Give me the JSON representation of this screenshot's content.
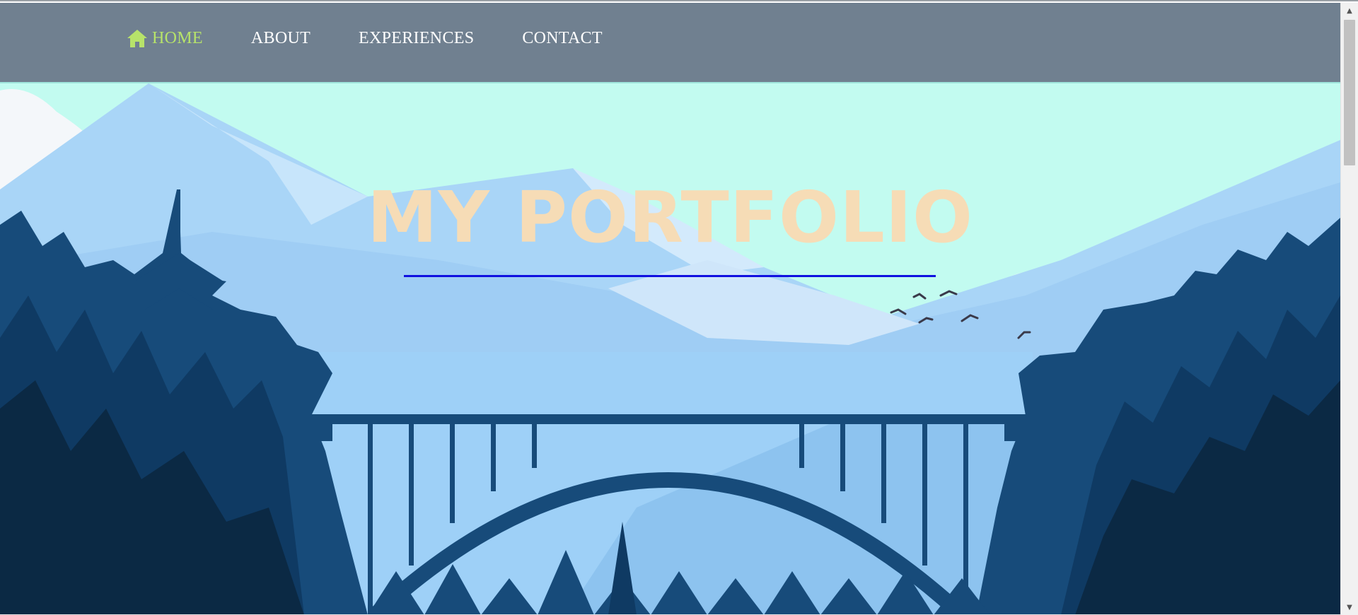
{
  "nav": {
    "items": [
      {
        "label": "HOME",
        "active": true,
        "icon": "home-icon"
      },
      {
        "label": "ABOUT",
        "active": false
      },
      {
        "label": "EXPERIENCES",
        "active": false
      },
      {
        "label": "CONTACT",
        "active": false
      }
    ]
  },
  "hero": {
    "title": "MY PORTFOLIO"
  },
  "colors": {
    "navbar_bg": "#708090",
    "nav_text": "#ffffff",
    "nav_active": "#b7e36a",
    "title": "#f6dcb6",
    "rule": "#1010e0",
    "sky": "#c2fbf0"
  }
}
